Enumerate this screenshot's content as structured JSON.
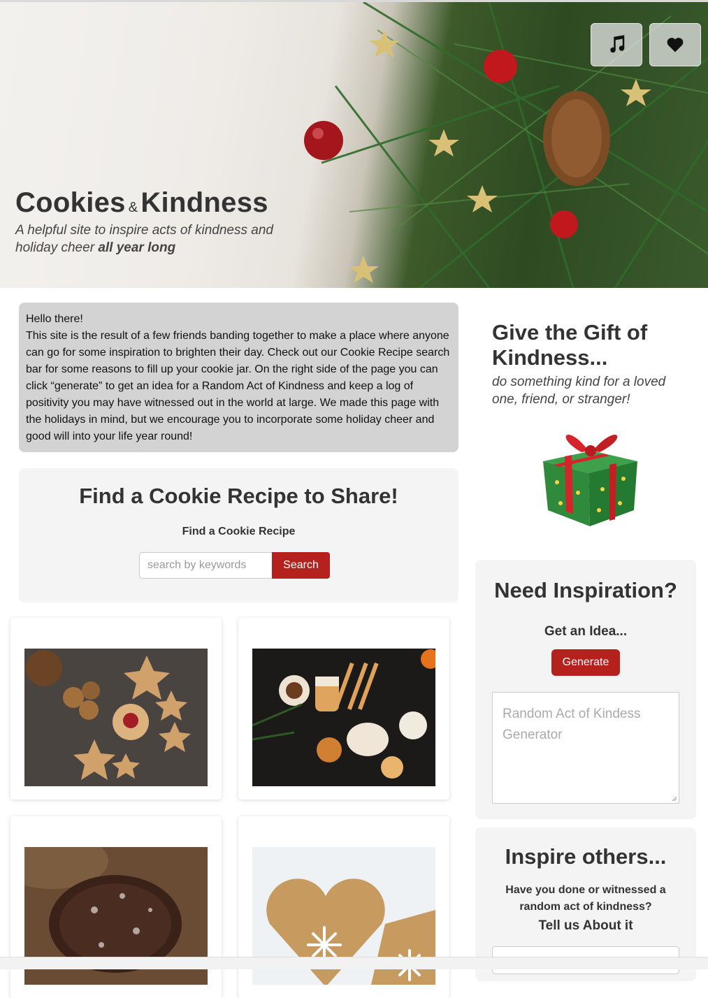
{
  "header": {
    "title_part1": "Cookies",
    "title_amp": "&",
    "title_part2": "Kindness",
    "subtitle_main": "A helpful site to inspire acts of kindness and holiday cheer",
    "subtitle_emphasis": "all year long",
    "buttons": [
      {
        "icon": "music-note-icon"
      },
      {
        "icon": "heart-icon"
      }
    ]
  },
  "intro": {
    "greeting": "Hello there!",
    "body": "This site is the result of a few friends banding together to make a place where anyone can go for some inspiration to brighten their day. Check out our Cookie Recipe search bar for some reasons to fill up your cookie jar. On the right side of the page you can click “generate” to get an idea for a Random Act of Kindness and keep a log of positivity you may have witnessed out in the world at large. We made this page with the holidays in mind, but we encourage you to incorporate some holiday cheer and good will into your life year round!"
  },
  "recipe_search": {
    "heading": "Find a Cookie Recipe to Share!",
    "label": "Find a Cookie Recipe",
    "placeholder": "search by keywords",
    "value": "",
    "button": "Search"
  },
  "recipe_cards": [
    {
      "image": "star-cookies-photo"
    },
    {
      "image": "gingerbread-cookies-photo"
    },
    {
      "image": "chocolate-cookie-photo"
    },
    {
      "image": "heart-cookie-photo"
    }
  ],
  "gift": {
    "title": "Give the Gift of Kindness...",
    "subtitle": "do something kind for a loved one, friend, or stranger!",
    "image": "gift-box-icon"
  },
  "inspiration": {
    "heading": "Need Inspiration?",
    "label": "Get an Idea...",
    "button": "Generate",
    "output_placeholder": "Random Act of Kindess Generator"
  },
  "inspire_others": {
    "heading": "Inspire others...",
    "question": "Have you done or witnessed a random act of kindness?",
    "cta": "Tell us About it"
  },
  "colors": {
    "accent_red": "#b5221e",
    "panel_gray": "#f4f4f4",
    "intro_gray": "#d3d3d3"
  }
}
